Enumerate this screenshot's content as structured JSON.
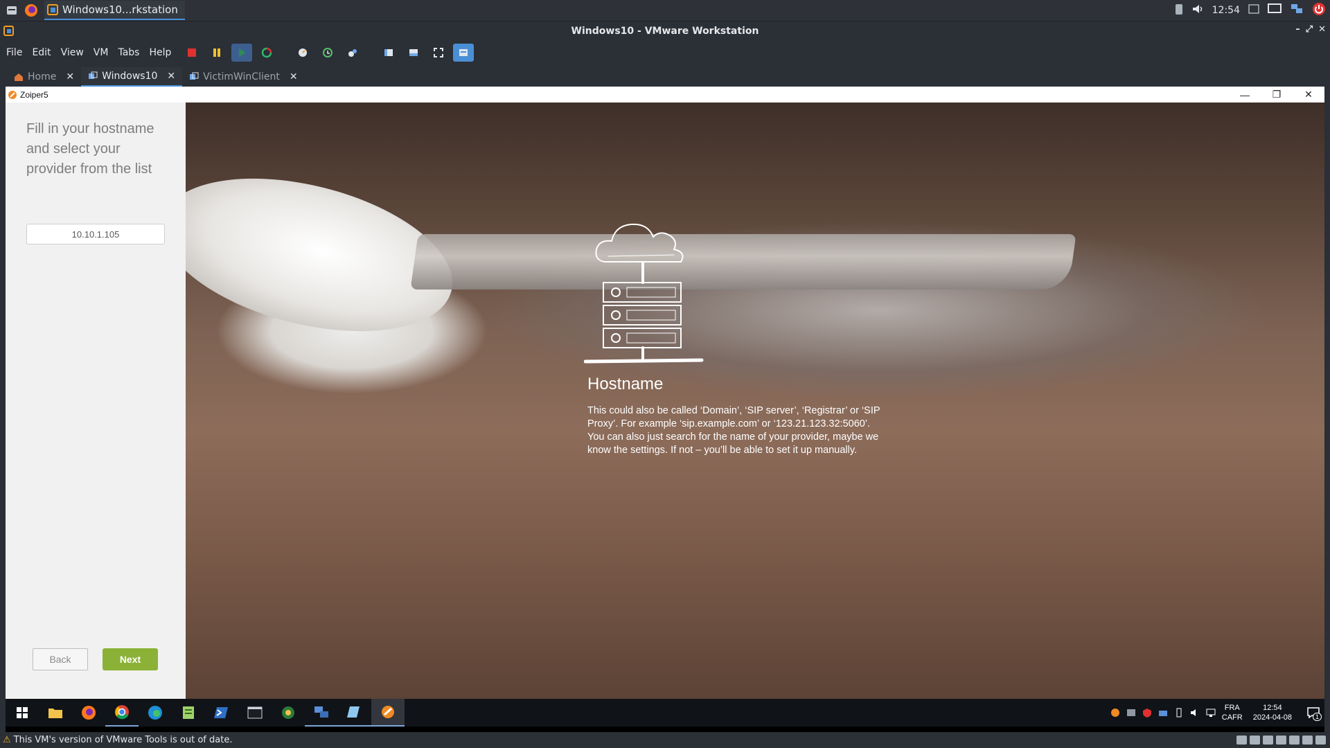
{
  "host_panel": {
    "task_label": "Windows10...rkstation",
    "clock": "12:54"
  },
  "vmware": {
    "title": "Windows10 - VMware Workstation",
    "menu": [
      "File",
      "Edit",
      "View",
      "VM",
      "Tabs",
      "Help"
    ],
    "tabs": [
      {
        "label": "Home",
        "active": false
      },
      {
        "label": "Windows10",
        "active": true
      },
      {
        "label": "VictimWinClient",
        "active": false
      }
    ],
    "status_message": "This VM's version of VMware Tools is out of date."
  },
  "zoiper": {
    "window_title": "Zoiper5",
    "sidebar_heading": "Fill in your hostname and select your provider from the list",
    "hostname_value": "10.10.1.105",
    "back_label": "Back",
    "next_label": "Next",
    "main_heading": "Hostname",
    "description_1": " This could also be called ‘Domain’, ‘SIP server’, ‘Registrar’ or ‘SIP Proxy’. For example ‘sip.example.com’ or ‘123.21.123.32:5060’.",
    "description_2": "You can also just search for the name of your provider, maybe we know the settings. If not – you’ll be able to set it up manually."
  },
  "windows_taskbar": {
    "lang": "FRA",
    "layout": "CAFR",
    "time": "12:54",
    "date": "2024-04-08",
    "notification_count": "1"
  },
  "colors": {
    "next_button": "#8bb136",
    "vmware_bg": "#2b2f36",
    "tab_accent": "#4a90d9"
  }
}
